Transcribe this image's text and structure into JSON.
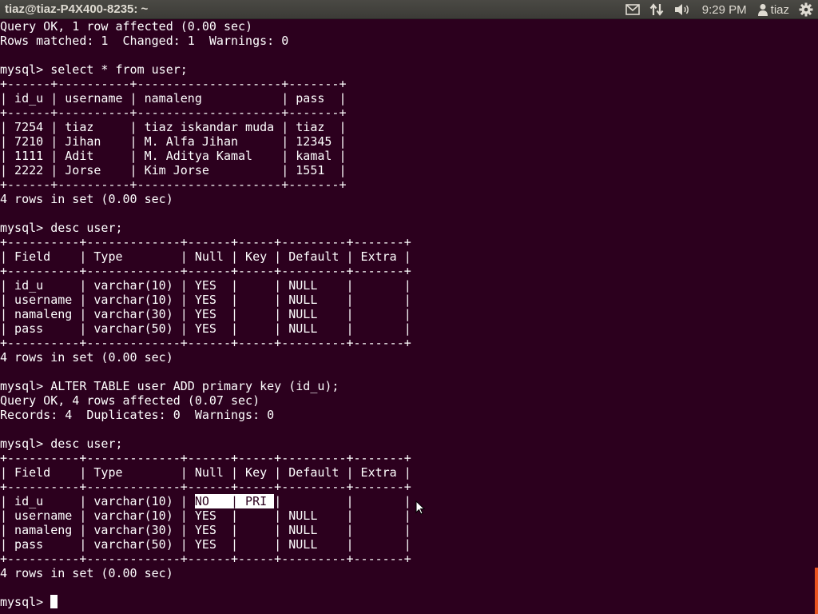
{
  "window": {
    "title": "tiaz@tiaz-P4X400-8235: ~"
  },
  "indicators": {
    "mail_icon": "mail-icon",
    "network_icon": "network-icon",
    "sound_icon": "sound-icon",
    "clock": "9:29 PM",
    "user_icon": "user-icon",
    "user": "tiaz",
    "gear_icon": "gear-icon"
  },
  "terminal": {
    "lines": [
      "Query OK, 1 row affected (0.00 sec)",
      "Rows matched: 1  Changed: 1  Warnings: 0",
      "",
      "mysql> select * from user;",
      "+------+----------+--------------------+-------+",
      "| id_u | username | namaleng           | pass  |",
      "+------+----------+--------------------+-------+",
      "| 7254 | tiaz     | tiaz iskandar muda | tiaz  |",
      "| 7210 | Jihan    | M. Alfa Jihan      | 12345 |",
      "| 1111 | Adit     | M. Aditya Kamal    | kamal |",
      "| 2222 | Jorse    | Kim Jorse          | 1551  |",
      "+------+----------+--------------------+-------+",
      "4 rows in set (0.00 sec)",
      "",
      "mysql> desc user;",
      "+----------+-------------+------+-----+---------+-------+",
      "| Field    | Type        | Null | Key | Default | Extra |",
      "+----------+-------------+------+-----+---------+-------+",
      "| id_u     | varchar(10) | YES  |     | NULL    |       |",
      "| username | varchar(10) | YES  |     | NULL    |       |",
      "| namaleng | varchar(30) | YES  |     | NULL    |       |",
      "| pass     | varchar(50) | YES  |     | NULL    |       |",
      "+----------+-------------+------+-----+---------+-------+",
      "4 rows in set (0.00 sec)",
      "",
      "mysql> ALTER TABLE user ADD primary key (id_u);",
      "Query OK, 4 rows affected (0.07 sec)",
      "Records: 4  Duplicates: 0  Warnings: 0",
      "",
      "mysql> desc user;",
      "+----------+-------------+------+-----+---------+-------+",
      "| Field    | Type        | Null | Key | Default | Extra |",
      "+----------+-------------+------+-----+---------+-------+"
    ],
    "highlight_row": {
      "before": "| id_u     | varchar(10) | ",
      "selected": "NO   | PRI ",
      "after": "|         |       |"
    },
    "lines_after": [
      "| username | varchar(10) | YES  |     | NULL    |       |",
      "| namaleng | varchar(30) | YES  |     | NULL    |       |",
      "| pass     | varchar(50) | YES  |     | NULL    |       |",
      "+----------+-------------+------+-----+---------+-------+",
      "4 rows in set (0.00 sec)",
      ""
    ],
    "prompt": "mysql> "
  },
  "colors": {
    "terminal_bg": "#2c001e",
    "terminal_fg": "#ffffff",
    "panel_bg": "#3c3b37",
    "accent": "#e95420"
  }
}
